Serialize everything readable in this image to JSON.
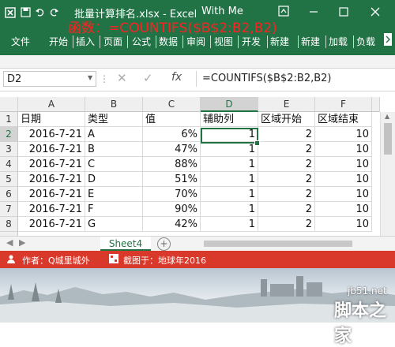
{
  "titlebar": {
    "title": "批量计算排名.xlsx - Excel",
    "user": "With Me",
    "qa_icons": [
      "excel-logo-icon",
      "save-icon",
      "undo-icon",
      "redo-icon"
    ],
    "window_buttons": [
      "help-icon",
      "minimize-icon",
      "maximize-icon",
      "close-icon"
    ]
  },
  "overlay": {
    "formula_note": "函数：=COUNTIFS($B$2:B2,B2)"
  },
  "ribbon": {
    "tabs": [
      "文件",
      "开始",
      "插入",
      "页面",
      "公式",
      "数据",
      "审阅",
      "视图",
      "开发",
      "新建",
      "新建",
      "加载",
      "负载"
    ]
  },
  "formula_bar": {
    "name_box": "D2",
    "fx_label": "fx",
    "formula": "=COUNTIFS($B$2:B2,B2)"
  },
  "sheet": {
    "columns": [
      "A",
      "B",
      "C",
      "D",
      "E",
      "F"
    ],
    "selected_column": "D",
    "selected_row": "2",
    "row_numbers": [
      "1",
      "2",
      "3",
      "4",
      "5",
      "6",
      "7",
      "8"
    ],
    "header": [
      "日期",
      "类型",
      "值",
      "辅助列",
      "区域开始",
      "区域结束"
    ],
    "rows": [
      [
        "2016-7-21",
        "A",
        "6%",
        "1",
        "2",
        "10"
      ],
      [
        "2016-7-21",
        "B",
        "47%",
        "1",
        "2",
        "10"
      ],
      [
        "2016-7-21",
        "C",
        "88%",
        "1",
        "2",
        "10"
      ],
      [
        "2016-7-21",
        "D",
        "51%",
        "1",
        "2",
        "10"
      ],
      [
        "2016-7-21",
        "E",
        "70%",
        "1",
        "2",
        "10"
      ],
      [
        "2016-7-21",
        "F",
        "90%",
        "1",
        "2",
        "10"
      ],
      [
        "2016-7-21",
        "G",
        "42%",
        "1",
        "2",
        "10"
      ]
    ]
  },
  "sheet_tabs": {
    "active": "Sheet4",
    "add_symbol": "+"
  },
  "credit": {
    "author": "作者：Q城里城外",
    "captured": "截图于：地球年2016"
  },
  "watermark": {
    "url": "jb51.net",
    "name": "脚本之家"
  },
  "colors": {
    "excel_green": "#217346",
    "credit_red": "#d9392b",
    "formula_red": "#ff2020"
  }
}
